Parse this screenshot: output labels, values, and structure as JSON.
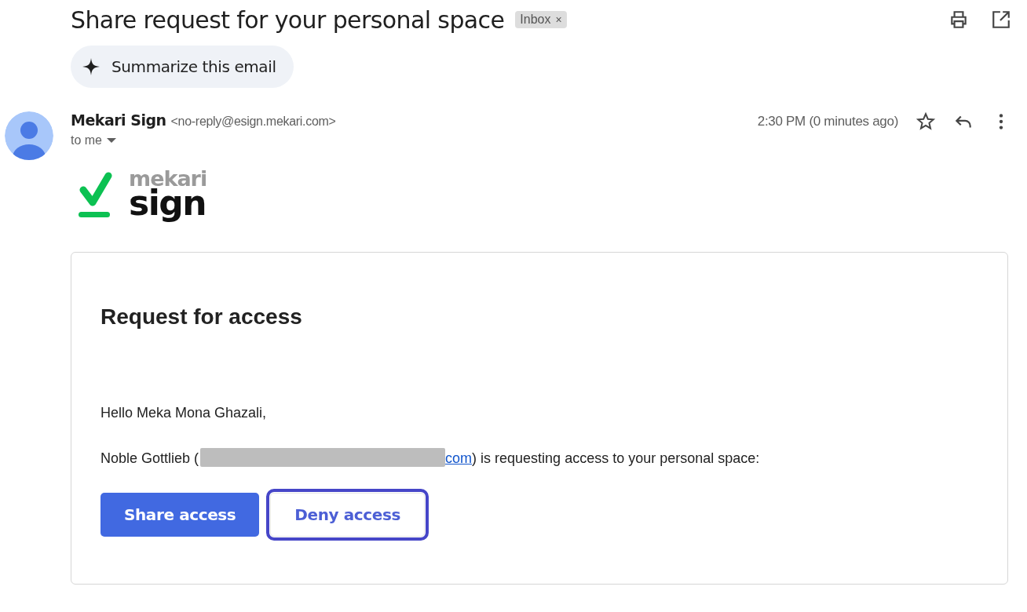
{
  "subject": "Share request for your personal space",
  "label": {
    "text": "Inbox",
    "remove": "×"
  },
  "summarize_button": "Summarize this email",
  "sender": {
    "name": "Mekari Sign",
    "email": "<no-reply@esign.mekari.com>",
    "recipient": "to me",
    "time": "2:30 PM (0 minutes ago)",
    "starred": false
  },
  "logo": {
    "top": "mekari",
    "bottom": "sign"
  },
  "card": {
    "heading": "Request for access",
    "greeting": "Hello Meka Mona Ghazali,",
    "request": {
      "before": "Noble Gottlieb (",
      "link": "com",
      "after": ") is requesting access to your personal space:"
    },
    "buttons": [
      {
        "label": "Share access",
        "kind": "primary",
        "highlighted": false
      },
      {
        "label": "Deny access",
        "kind": "secondary",
        "highlighted": true
      }
    ]
  }
}
